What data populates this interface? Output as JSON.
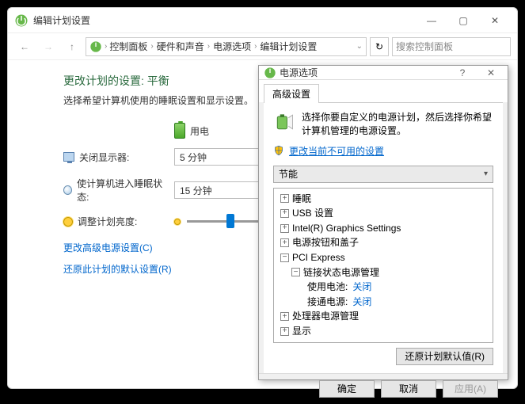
{
  "window": {
    "title": "编辑计划设置",
    "btn_min": "—",
    "btn_max": "▢",
    "btn_close": "✕"
  },
  "breadcrumb": {
    "items": [
      "控制面板",
      "硬件和声音",
      "电源选项",
      "编辑计划设置"
    ],
    "sep": "›"
  },
  "search": {
    "placeholder": "搜索控制面板"
  },
  "page": {
    "heading": "更改计划的设置: 平衡",
    "subheading": "选择希望计算机使用的睡眠设置和显示设置。",
    "battery_header": "用电",
    "row_display": {
      "label": "关闭显示器:",
      "value": "5 分钟"
    },
    "row_sleep": {
      "label": "使计算机进入睡眠状态:",
      "value": "15 分钟"
    },
    "row_brightness": {
      "label": "调整计划亮度:"
    },
    "link_advanced": "更改高级电源设置(C)",
    "link_restore": "还原此计划的默认设置(R)"
  },
  "dialog": {
    "title": "电源选项",
    "help": "?",
    "close": "✕",
    "tab": "高级设置",
    "description": "选择你要自定义的电源计划，然后选择你希望计算机管理的电源设置。",
    "change_link": "更改当前不可用的设置",
    "plan_selected": "节能",
    "tree": {
      "sleep": "睡眠",
      "usb": "USB 设置",
      "intel": "Intel(R) Graphics Settings",
      "powerbtn": "电源按钮和盖子",
      "pci": "PCI Express",
      "linkstate": "链接状态电源管理",
      "onbattery_label": "使用电池:",
      "onbattery_value": "关闭",
      "plugged_label": "接通电源:",
      "plugged_value": "关闭",
      "cpu": "处理器电源管理",
      "display": "显示"
    },
    "restore_defaults": "还原计划默认值(R)",
    "ok": "确定",
    "cancel": "取消",
    "apply": "应用(A)",
    "expander_plus": "+",
    "expander_minus": "−"
  }
}
